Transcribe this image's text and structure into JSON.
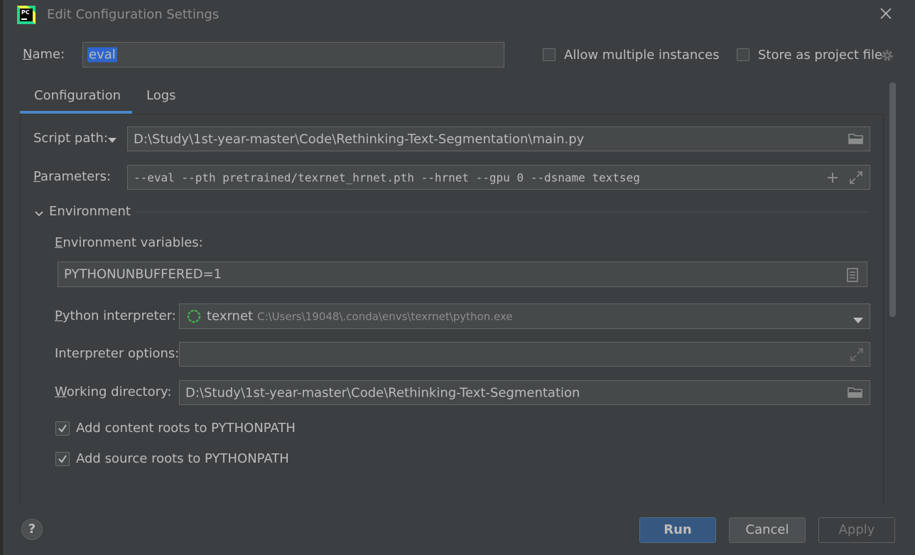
{
  "window": {
    "title": "Edit Configuration Settings",
    "app_icon_text": "PC"
  },
  "name_row": {
    "label": "Name:",
    "value": "eval",
    "allow_multiple": "Allow multiple instances",
    "store_as_project": "Store as project file"
  },
  "tabs": [
    {
      "label": "Configuration",
      "active": true
    },
    {
      "label": "Logs",
      "active": false
    }
  ],
  "config": {
    "script_path_label": "Script path:",
    "script_path_value": "D:\\Study\\1st-year-master\\Code\\Rethinking-Text-Segmentation\\main.py",
    "parameters_label": "Parameters:",
    "parameters_value": "--eval --pth pretrained/texrnet_hrnet.pth --hrnet --gpu 0 --dsname textseg",
    "environment_label": "Environment",
    "env_vars_label": "Environment variables:",
    "env_vars_value": "PYTHONUNBUFFERED=1",
    "interpreter_label": "Python interpreter:",
    "interpreter_name": "texrnet",
    "interpreter_path": "C:\\Users\\19048\\.conda\\envs\\texrnet\\python.exe",
    "interp_options_label": "Interpreter options:",
    "interp_options_value": "",
    "working_dir_label": "Working directory:",
    "working_dir_value": "D:\\Study\\1st-year-master\\Code\\Rethinking-Text-Segmentation",
    "content_roots_label": "Add content roots to PYTHONPATH",
    "content_roots_checked": true,
    "source_roots_label": "Add source roots to PYTHONPATH",
    "source_roots_checked": true
  },
  "buttons": {
    "run": "Run",
    "cancel": "Cancel",
    "apply": "Apply",
    "help": "?"
  },
  "colors": {
    "dialog_bg": "#3c3f41",
    "field_bg": "#45494a",
    "accent": "#4a88c7",
    "run_button": "#365880",
    "selection": "#2f65ca"
  }
}
